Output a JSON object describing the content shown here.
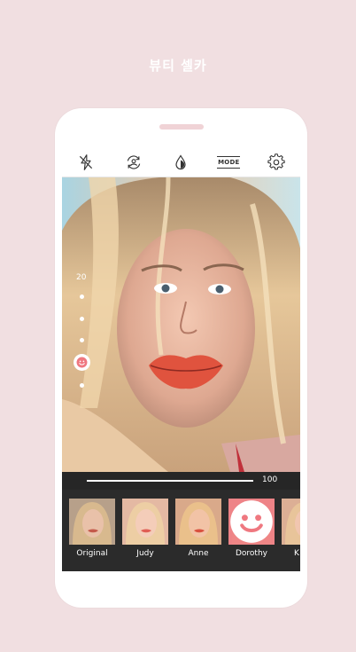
{
  "headline": "뷰티 셀카",
  "toolbar": {
    "icons": [
      "flash-off-icon",
      "switch-camera-icon",
      "drop-icon",
      "mode-icon",
      "gear-icon"
    ],
    "mode_label": "MODE"
  },
  "beauty_level": {
    "label": "20",
    "steps": 5,
    "selected_step": 4,
    "icon": "smile-icon"
  },
  "strength": {
    "value": "100",
    "fraction": 1.0
  },
  "filters": [
    {
      "name": "Original",
      "selected": false
    },
    {
      "name": "Judy",
      "selected": false
    },
    {
      "name": "Anne",
      "selected": false
    },
    {
      "name": "Dorothy",
      "selected": true
    },
    {
      "name": "K",
      "selected": false
    }
  ],
  "colors": {
    "background": "#f1dfe1",
    "selected_filter": "#ef7880",
    "dark_panel": "#2b2b2b"
  }
}
